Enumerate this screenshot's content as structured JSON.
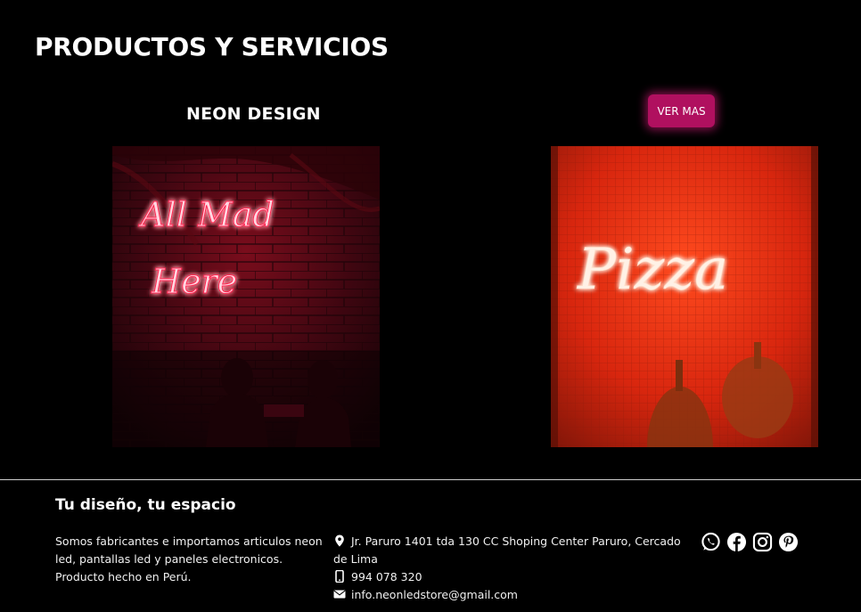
{
  "page": {
    "title": "PRODUCTOS Y SERVICIOS"
  },
  "section": {
    "title": "NEON DESIGN",
    "button_label": "VER MAS",
    "accent_color": "#b0105f"
  },
  "images": {
    "left": {
      "neon_text_line1": "All Mad",
      "neon_text_line2": "Here"
    },
    "right": {
      "neon_text": "Pizza"
    }
  },
  "footer": {
    "title": "Tu diseño, tu espacio",
    "description": "Somos fabricantes e importamos articulos neon led, pantallas led y paneles electronicos. Producto hecho en Perú.",
    "address": "Jr. Paruro 1401 tda 130 CC Shoping Center Paruro, Cercado de Lima",
    "phone": "994 078 320",
    "email": "info.neonledstore@gmail.com",
    "socials": [
      "whatsapp-icon",
      "facebook-icon",
      "instagram-icon",
      "pinterest-icon"
    ]
  }
}
